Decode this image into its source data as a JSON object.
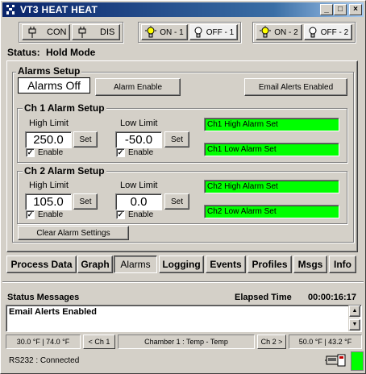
{
  "window": {
    "title": "VT3 HEAT HEAT",
    "minimize_glyph": "_",
    "maximize_glyph": "□",
    "close_glyph": "×"
  },
  "toolbar": {
    "con_label": "CON",
    "dis_label": "DIS",
    "on1_label": "ON - 1",
    "off1_label": "OFF - 1",
    "on2_label": "ON - 2",
    "off2_label": "OFF - 2"
  },
  "status": {
    "label": "Status:",
    "value": "Hold Mode"
  },
  "alarms_setup": {
    "title": "Alarms Setup",
    "alarms_state": "Alarms Off",
    "alarm_enable_label": "Alarm Enable",
    "email_alerts_label": "Email Alerts Enabled",
    "clear_label": "Clear Alarm Settings",
    "ch1": {
      "title": "Ch 1 Alarm Setup",
      "high_label": "High Limit",
      "low_label": "Low Limit",
      "high_value": "250.0",
      "low_value": "-50.0",
      "set_label": "Set",
      "enable_label": "Enable",
      "high_status": "Ch1 High Alarm Set",
      "low_status": "Ch1 Low Alarm Set"
    },
    "ch2": {
      "title": "Ch 2 Alarm Setup",
      "high_label": "High Limit",
      "low_label": "Low Limit",
      "high_value": "105.0",
      "low_value": "0.0",
      "set_label": "Set",
      "enable_label": "Enable",
      "high_status": "Ch2 High Alarm Set",
      "low_status": "Ch2 Low Alarm Set"
    },
    "status_color": "#00ff00"
  },
  "tabs": [
    "Process Data",
    "Graph",
    "Alarms",
    "Logging",
    "Events",
    "Profiles",
    "Msgs",
    "Info"
  ],
  "active_tab": "Alarms",
  "messages": {
    "title": "Status Messages",
    "elapsed_label": "Elapsed Time",
    "elapsed_value": "00:00:16:17",
    "text": "Email Alerts Enabled"
  },
  "statusbar": {
    "ch1_temps": "30.0 °F  |  74.0 °F",
    "prev_ch": "< Ch 1",
    "chamber": "Chamber 1 : Temp - Temp",
    "next_ch": "Ch 2 >",
    "ch2_temps": "50.0 °F  |  43.2 °F",
    "connection": "RS232 : Connected",
    "connected_color": "#00ff00"
  },
  "icons": [
    "app-icon",
    "connect-plug-icon",
    "disconnect-plug-icon",
    "bulb-on-icon",
    "bulb-off-icon",
    "serial-connection-icon"
  ]
}
